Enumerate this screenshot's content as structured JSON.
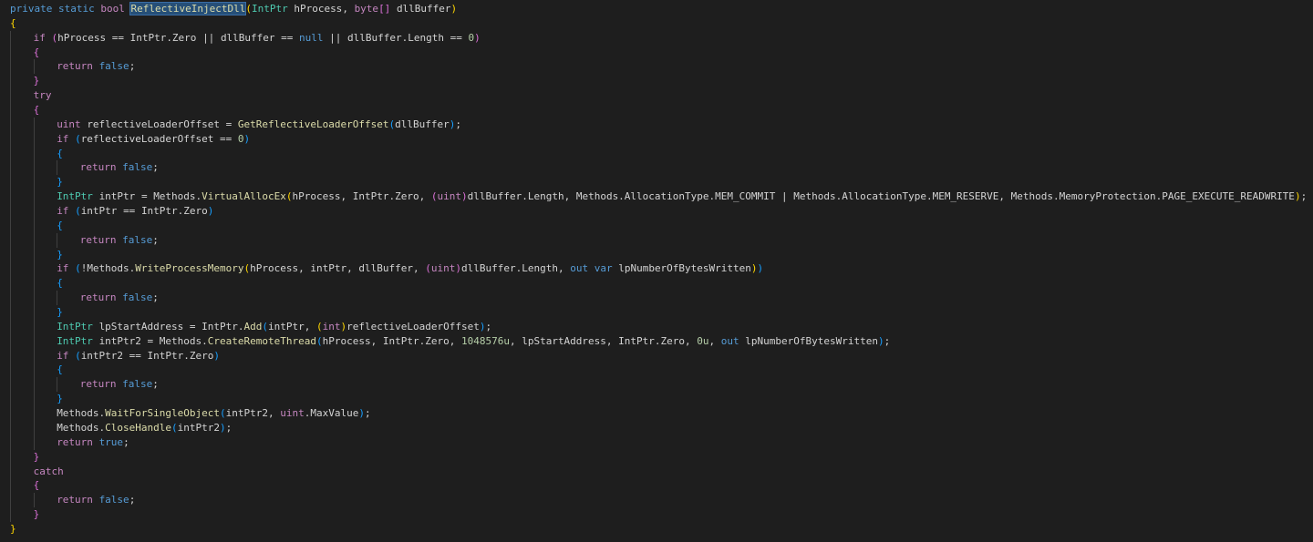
{
  "editor": {
    "colors": {
      "background": "#1e1e1e",
      "keyword": "#569cd6",
      "control": "#c586c0",
      "type": "#4ec9b0",
      "function": "#dcdcaa",
      "number": "#b5cea8",
      "identifier": "#d4d4d4",
      "bracket_level_0": "#ffd700",
      "bracket_level_1": "#da70d6",
      "bracket_level_2": "#179fff",
      "selection": "#264f78"
    },
    "lines": [
      {
        "indent": 0,
        "tokens": [
          [
            "kw",
            "private"
          ],
          [
            "sp",
            " "
          ],
          [
            "kw",
            "static"
          ],
          [
            "sp",
            " "
          ],
          [
            "ctl",
            "bool"
          ],
          [
            "sp",
            " "
          ],
          [
            "fn-sel",
            "ReflectiveInjectDll"
          ],
          [
            "b0",
            "("
          ],
          [
            "type",
            "IntPtr"
          ],
          [
            "sp",
            " "
          ],
          [
            "id",
            "hProcess"
          ],
          [
            "punc",
            ","
          ],
          [
            "sp",
            " "
          ],
          [
            "ctl",
            "byte"
          ],
          [
            "b1",
            "[]"
          ],
          [
            "sp",
            " "
          ],
          [
            "id",
            "dllBuffer"
          ],
          [
            "b0",
            ")"
          ]
        ]
      },
      {
        "indent": 0,
        "tokens": [
          [
            "b0",
            "{"
          ]
        ]
      },
      {
        "indent": 1,
        "tokens": [
          [
            "ctl",
            "if"
          ],
          [
            "sp",
            " "
          ],
          [
            "b1",
            "("
          ],
          [
            "id",
            "hProcess"
          ],
          [
            "sp",
            " "
          ],
          [
            "punc",
            "=="
          ],
          [
            "sp",
            " "
          ],
          [
            "id",
            "IntPtr.Zero"
          ],
          [
            "sp",
            " "
          ],
          [
            "punc",
            "||"
          ],
          [
            "sp",
            " "
          ],
          [
            "id",
            "dllBuffer"
          ],
          [
            "sp",
            " "
          ],
          [
            "punc",
            "=="
          ],
          [
            "sp",
            " "
          ],
          [
            "kw",
            "null"
          ],
          [
            "sp",
            " "
          ],
          [
            "punc",
            "||"
          ],
          [
            "sp",
            " "
          ],
          [
            "id",
            "dllBuffer.Length"
          ],
          [
            "sp",
            " "
          ],
          [
            "punc",
            "=="
          ],
          [
            "sp",
            " "
          ],
          [
            "num",
            "0"
          ],
          [
            "b1",
            ")"
          ]
        ]
      },
      {
        "indent": 1,
        "tokens": [
          [
            "b1",
            "{"
          ]
        ]
      },
      {
        "indent": 2,
        "tokens": [
          [
            "ctl",
            "return"
          ],
          [
            "sp",
            " "
          ],
          [
            "kw",
            "false"
          ],
          [
            "punc",
            ";"
          ]
        ]
      },
      {
        "indent": 1,
        "tokens": [
          [
            "b1",
            "}"
          ]
        ]
      },
      {
        "indent": 1,
        "tokens": [
          [
            "ctl",
            "try"
          ]
        ]
      },
      {
        "indent": 1,
        "tokens": [
          [
            "b1",
            "{"
          ]
        ]
      },
      {
        "indent": 2,
        "tokens": [
          [
            "ctl",
            "uint"
          ],
          [
            "sp",
            " "
          ],
          [
            "id",
            "reflectiveLoaderOffset"
          ],
          [
            "sp",
            " "
          ],
          [
            "punc",
            "="
          ],
          [
            "sp",
            " "
          ],
          [
            "fn",
            "GetReflectiveLoaderOffset"
          ],
          [
            "b2",
            "("
          ],
          [
            "id",
            "dllBuffer"
          ],
          [
            "b2",
            ")"
          ],
          [
            "punc",
            ";"
          ]
        ]
      },
      {
        "indent": 2,
        "tokens": [
          [
            "ctl",
            "if"
          ],
          [
            "sp",
            " "
          ],
          [
            "b2",
            "("
          ],
          [
            "id",
            "reflectiveLoaderOffset"
          ],
          [
            "sp",
            " "
          ],
          [
            "punc",
            "=="
          ],
          [
            "sp",
            " "
          ],
          [
            "num",
            "0"
          ],
          [
            "b2",
            ")"
          ]
        ]
      },
      {
        "indent": 2,
        "tokens": [
          [
            "b2",
            "{"
          ]
        ]
      },
      {
        "indent": 3,
        "tokens": [
          [
            "ctl",
            "return"
          ],
          [
            "sp",
            " "
          ],
          [
            "kw",
            "false"
          ],
          [
            "punc",
            ";"
          ]
        ]
      },
      {
        "indent": 2,
        "tokens": [
          [
            "b2",
            "}"
          ]
        ]
      },
      {
        "indent": 2,
        "tokens": [
          [
            "type",
            "IntPtr"
          ],
          [
            "sp",
            " "
          ],
          [
            "id",
            "intPtr"
          ],
          [
            "sp",
            " "
          ],
          [
            "punc",
            "="
          ],
          [
            "sp",
            " "
          ],
          [
            "id",
            "Methods."
          ],
          [
            "fn",
            "VirtualAllocEx"
          ],
          [
            "b0",
            "("
          ],
          [
            "id",
            "hProcess"
          ],
          [
            "punc",
            ","
          ],
          [
            "sp",
            " "
          ],
          [
            "id",
            "IntPtr.Zero"
          ],
          [
            "punc",
            ","
          ],
          [
            "sp",
            " "
          ],
          [
            "b1",
            "("
          ],
          [
            "ctl",
            "uint"
          ],
          [
            "b1",
            ")"
          ],
          [
            "id",
            "dllBuffer.Length"
          ],
          [
            "punc",
            ","
          ],
          [
            "sp",
            " "
          ],
          [
            "id",
            "Methods.AllocationType.MEM_COMMIT"
          ],
          [
            "sp",
            " "
          ],
          [
            "punc",
            "|"
          ],
          [
            "sp",
            " "
          ],
          [
            "id",
            "Methods.AllocationType.MEM_RESERVE"
          ],
          [
            "punc",
            ","
          ],
          [
            "sp",
            " "
          ],
          [
            "id",
            "Methods.MemoryProtection.PAGE_EXECUTE_READWRITE"
          ],
          [
            "b0",
            ")"
          ],
          [
            "punc",
            ";"
          ]
        ]
      },
      {
        "indent": 2,
        "tokens": [
          [
            "ctl",
            "if"
          ],
          [
            "sp",
            " "
          ],
          [
            "b2",
            "("
          ],
          [
            "id",
            "intPtr"
          ],
          [
            "sp",
            " "
          ],
          [
            "punc",
            "=="
          ],
          [
            "sp",
            " "
          ],
          [
            "id",
            "IntPtr.Zero"
          ],
          [
            "b2",
            ")"
          ]
        ]
      },
      {
        "indent": 2,
        "tokens": [
          [
            "b2",
            "{"
          ]
        ]
      },
      {
        "indent": 3,
        "tokens": [
          [
            "ctl",
            "return"
          ],
          [
            "sp",
            " "
          ],
          [
            "kw",
            "false"
          ],
          [
            "punc",
            ";"
          ]
        ]
      },
      {
        "indent": 2,
        "tokens": [
          [
            "b2",
            "}"
          ]
        ]
      },
      {
        "indent": 2,
        "tokens": [
          [
            "ctl",
            "if"
          ],
          [
            "sp",
            " "
          ],
          [
            "b2",
            "("
          ],
          [
            "punc",
            "!"
          ],
          [
            "id",
            "Methods."
          ],
          [
            "fn",
            "WriteProcessMemory"
          ],
          [
            "b0",
            "("
          ],
          [
            "id",
            "hProcess"
          ],
          [
            "punc",
            ","
          ],
          [
            "sp",
            " "
          ],
          [
            "id",
            "intPtr"
          ],
          [
            "punc",
            ","
          ],
          [
            "sp",
            " "
          ],
          [
            "id",
            "dllBuffer"
          ],
          [
            "punc",
            ","
          ],
          [
            "sp",
            " "
          ],
          [
            "b1",
            "("
          ],
          [
            "ctl",
            "uint"
          ],
          [
            "b1",
            ")"
          ],
          [
            "id",
            "dllBuffer.Length"
          ],
          [
            "punc",
            ","
          ],
          [
            "sp",
            " "
          ],
          [
            "kw",
            "out"
          ],
          [
            "sp",
            " "
          ],
          [
            "kw",
            "var"
          ],
          [
            "sp",
            " "
          ],
          [
            "id",
            "lpNumberOfBytesWritten"
          ],
          [
            "b0",
            ")"
          ],
          [
            "b2",
            ")"
          ]
        ]
      },
      {
        "indent": 2,
        "tokens": [
          [
            "b2",
            "{"
          ]
        ]
      },
      {
        "indent": 3,
        "tokens": [
          [
            "ctl",
            "return"
          ],
          [
            "sp",
            " "
          ],
          [
            "kw",
            "false"
          ],
          [
            "punc",
            ";"
          ]
        ]
      },
      {
        "indent": 2,
        "tokens": [
          [
            "b2",
            "}"
          ]
        ]
      },
      {
        "indent": 2,
        "tokens": [
          [
            "type",
            "IntPtr"
          ],
          [
            "sp",
            " "
          ],
          [
            "id",
            "lpStartAddress"
          ],
          [
            "sp",
            " "
          ],
          [
            "punc",
            "="
          ],
          [
            "sp",
            " "
          ],
          [
            "id",
            "IntPtr."
          ],
          [
            "fn",
            "Add"
          ],
          [
            "b2",
            "("
          ],
          [
            "id",
            "intPtr"
          ],
          [
            "punc",
            ","
          ],
          [
            "sp",
            " "
          ],
          [
            "b0",
            "("
          ],
          [
            "ctl",
            "int"
          ],
          [
            "b0",
            ")"
          ],
          [
            "id",
            "reflectiveLoaderOffset"
          ],
          [
            "b2",
            ")"
          ],
          [
            "punc",
            ";"
          ]
        ]
      },
      {
        "indent": 2,
        "tokens": [
          [
            "type",
            "IntPtr"
          ],
          [
            "sp",
            " "
          ],
          [
            "id",
            "intPtr2"
          ],
          [
            "sp",
            " "
          ],
          [
            "punc",
            "="
          ],
          [
            "sp",
            " "
          ],
          [
            "id",
            "Methods."
          ],
          [
            "fn",
            "CreateRemoteThread"
          ],
          [
            "b2",
            "("
          ],
          [
            "id",
            "hProcess"
          ],
          [
            "punc",
            ","
          ],
          [
            "sp",
            " "
          ],
          [
            "id",
            "IntPtr.Zero"
          ],
          [
            "punc",
            ","
          ],
          [
            "sp",
            " "
          ],
          [
            "num",
            "1048576u"
          ],
          [
            "punc",
            ","
          ],
          [
            "sp",
            " "
          ],
          [
            "id",
            "lpStartAddress"
          ],
          [
            "punc",
            ","
          ],
          [
            "sp",
            " "
          ],
          [
            "id",
            "IntPtr.Zero"
          ],
          [
            "punc",
            ","
          ],
          [
            "sp",
            " "
          ],
          [
            "num",
            "0u"
          ],
          [
            "punc",
            ","
          ],
          [
            "sp",
            " "
          ],
          [
            "kw",
            "out"
          ],
          [
            "sp",
            " "
          ],
          [
            "id",
            "lpNumberOfBytesWritten"
          ],
          [
            "b2",
            ")"
          ],
          [
            "punc",
            ";"
          ]
        ]
      },
      {
        "indent": 2,
        "tokens": [
          [
            "ctl",
            "if"
          ],
          [
            "sp",
            " "
          ],
          [
            "b2",
            "("
          ],
          [
            "id",
            "intPtr2"
          ],
          [
            "sp",
            " "
          ],
          [
            "punc",
            "=="
          ],
          [
            "sp",
            " "
          ],
          [
            "id",
            "IntPtr.Zero"
          ],
          [
            "b2",
            ")"
          ]
        ]
      },
      {
        "indent": 2,
        "tokens": [
          [
            "b2",
            "{"
          ]
        ]
      },
      {
        "indent": 3,
        "tokens": [
          [
            "ctl",
            "return"
          ],
          [
            "sp",
            " "
          ],
          [
            "kw",
            "false"
          ],
          [
            "punc",
            ";"
          ]
        ]
      },
      {
        "indent": 2,
        "tokens": [
          [
            "b2",
            "}"
          ]
        ]
      },
      {
        "indent": 2,
        "tokens": [
          [
            "id",
            "Methods."
          ],
          [
            "fn",
            "WaitForSingleObject"
          ],
          [
            "b2",
            "("
          ],
          [
            "id",
            "intPtr2"
          ],
          [
            "punc",
            ","
          ],
          [
            "sp",
            " "
          ],
          [
            "ctl",
            "uint"
          ],
          [
            "id",
            ".MaxValue"
          ],
          [
            "b2",
            ")"
          ],
          [
            "punc",
            ";"
          ]
        ]
      },
      {
        "indent": 2,
        "tokens": [
          [
            "id",
            "Methods."
          ],
          [
            "fn",
            "CloseHandle"
          ],
          [
            "b2",
            "("
          ],
          [
            "id",
            "intPtr2"
          ],
          [
            "b2",
            ")"
          ],
          [
            "punc",
            ";"
          ]
        ]
      },
      {
        "indent": 2,
        "tokens": [
          [
            "ctl",
            "return"
          ],
          [
            "sp",
            " "
          ],
          [
            "kw",
            "true"
          ],
          [
            "punc",
            ";"
          ]
        ]
      },
      {
        "indent": 1,
        "tokens": [
          [
            "b1",
            "}"
          ]
        ]
      },
      {
        "indent": 1,
        "tokens": [
          [
            "ctl",
            "catch"
          ]
        ]
      },
      {
        "indent": 1,
        "tokens": [
          [
            "b1",
            "{"
          ]
        ]
      },
      {
        "indent": 2,
        "tokens": [
          [
            "ctl",
            "return"
          ],
          [
            "sp",
            " "
          ],
          [
            "kw",
            "false"
          ],
          [
            "punc",
            ";"
          ]
        ]
      },
      {
        "indent": 1,
        "tokens": [
          [
            "b1",
            "}"
          ]
        ]
      },
      {
        "indent": 0,
        "tokens": [
          [
            "b0",
            "}"
          ]
        ]
      }
    ]
  }
}
